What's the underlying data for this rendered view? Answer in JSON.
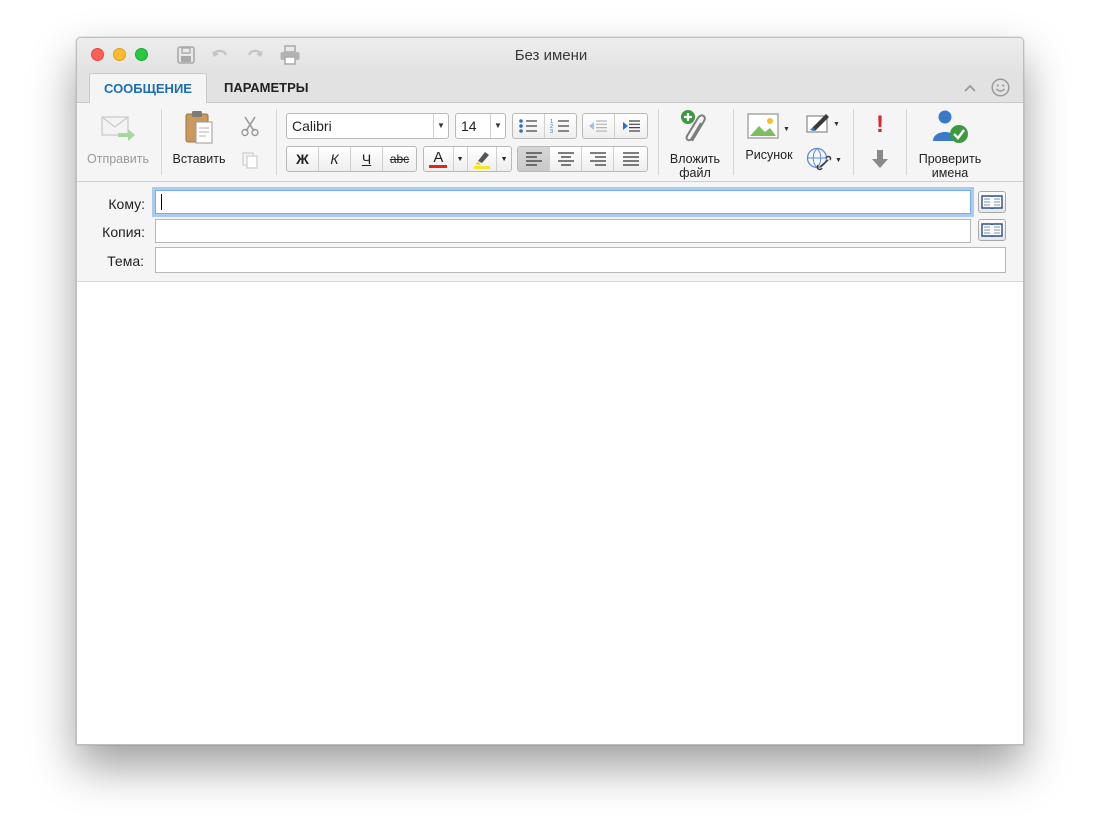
{
  "window": {
    "title": "Без имени"
  },
  "tabs": [
    {
      "label": "СООБЩЕНИЕ",
      "active": true
    },
    {
      "label": "ПАРАМЕТРЫ",
      "active": false
    }
  ],
  "ribbon": {
    "send_label": "Отправить",
    "paste_label": "Вставить",
    "font_name": "Calibri",
    "font_size": "14",
    "bold": "Ж",
    "italic": "К",
    "underline": "Ч",
    "strike": "abc",
    "font_color_letter": "A",
    "attach_label_1": "Вложить",
    "attach_label_2": "файл",
    "picture_label": "Рисунок",
    "check_names_1": "Проверить",
    "check_names_2": "имена",
    "high_importance": "!"
  },
  "fields": {
    "to_label": "Кому:",
    "cc_label": "Копия:",
    "subject_label": "Тема:",
    "to_value": "",
    "cc_value": "",
    "subject_value": ""
  },
  "colors": {
    "accent_tab": "#1b6db5",
    "font_color_bar": "#e0251b",
    "highlight_bar": "#f5e42b",
    "focus_ring": "#a9cbf0"
  }
}
